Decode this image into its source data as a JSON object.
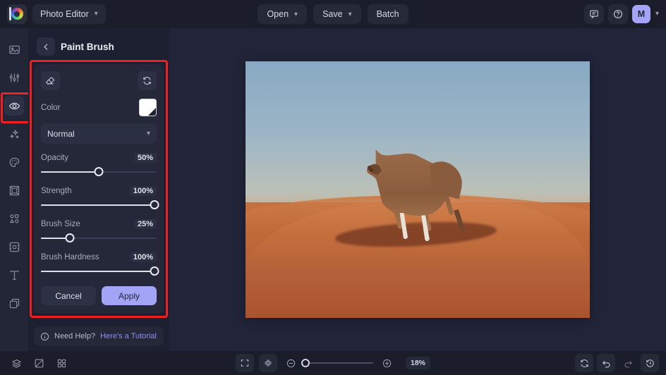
{
  "topbar": {
    "logo_icon": "color-wheel-logo-icon",
    "app_switcher_label": "Photo Editor",
    "app_switcher_caret": "chevron-down-icon",
    "open_label": "Open",
    "save_label": "Save",
    "batch_label": "Batch",
    "feedback_icon": "comment-icon",
    "help_icon": "question-circle-icon",
    "avatar_initial": "M",
    "account_caret": "chevron-down-icon"
  },
  "rail": {
    "items": [
      {
        "icon": "image-icon",
        "name": "sidebar-item-image",
        "active": false
      },
      {
        "icon": "sliders-icon",
        "name": "sidebar-item-adjust",
        "active": false
      },
      {
        "icon": "eye-icon",
        "name": "sidebar-item-retouch",
        "active": true
      },
      {
        "icon": "sparkles-icon",
        "name": "sidebar-item-ai-effects",
        "active": false
      },
      {
        "icon": "palette-icon",
        "name": "sidebar-item-color",
        "active": false
      },
      {
        "icon": "frame-icon",
        "name": "sidebar-item-frame",
        "active": false
      },
      {
        "icon": "shapes-icon",
        "name": "sidebar-item-elements",
        "active": false
      },
      {
        "icon": "crop-focus-icon",
        "name": "sidebar-item-crop",
        "active": false
      },
      {
        "icon": "text-icon",
        "name": "sidebar-item-text",
        "active": false
      },
      {
        "icon": "layers-copy-icon",
        "name": "sidebar-item-layers",
        "active": false
      }
    ]
  },
  "panel": {
    "back_icon": "arrow-left-icon",
    "title": "Paint Brush",
    "eraser_icon": "eraser-icon",
    "reset_icon": "reset-refresh-icon",
    "color_label": "Color",
    "color_value": "#ffffff",
    "blend_mode": "Normal",
    "blend_caret": "chevron-down-icon",
    "sliders": [
      {
        "label": "Opacity",
        "value": "50%",
        "percent": 50
      },
      {
        "label": "Strength",
        "value": "100%",
        "percent": 100
      },
      {
        "label": "Brush Size",
        "value": "25%",
        "percent": 25
      },
      {
        "label": "Brush Hardness",
        "value": "100%",
        "percent": 100
      }
    ],
    "cancel_label": "Cancel",
    "apply_label": "Apply",
    "apply_color": "#a3a4f5",
    "help_icon": "info-circle-icon",
    "help_text": "Need Help?",
    "help_link": "Here's a Tutorial",
    "highlight_color": "#ef2020"
  },
  "canvas": {
    "image_description": "camel walking across orange desert sand dunes under a blue sky"
  },
  "bottombar": {
    "layers_icon": "layers-icon",
    "compare_icon": "compare-split-icon",
    "grid_icon": "grid-four-icon",
    "fit_icon": "fit-to-screen-icon",
    "shrink_icon": "shrink-to-fit-icon",
    "zoom_out_icon": "zoom-out-icon",
    "zoom_in_icon": "zoom-in-icon",
    "zoom_level": "18%",
    "zoom_percent": 0,
    "reset_icon": "reset-refresh-icon",
    "undo_icon": "undo-icon",
    "redo_icon": "redo-icon",
    "history_icon": "history-clock-icon"
  }
}
